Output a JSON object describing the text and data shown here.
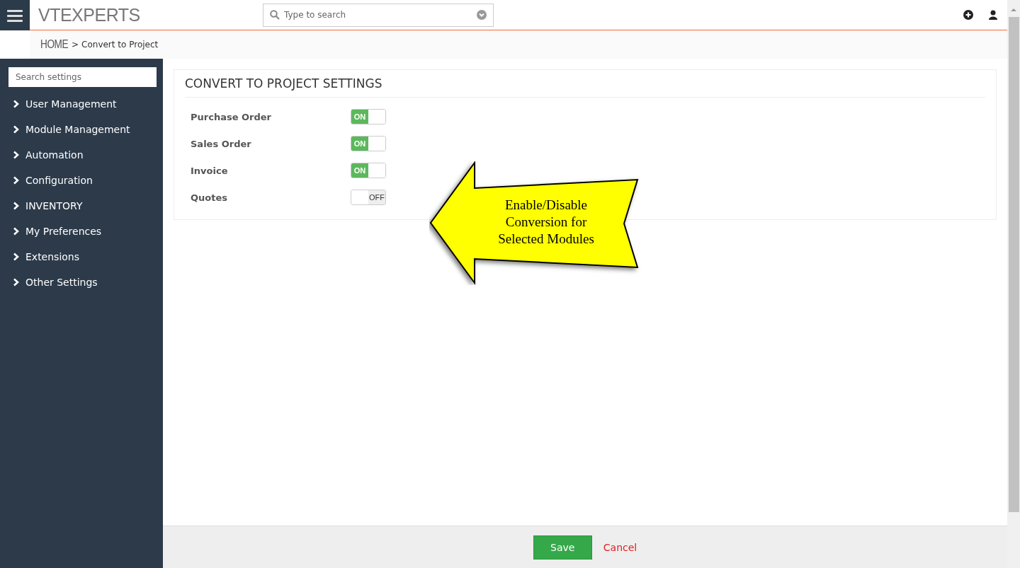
{
  "header": {
    "logo": "VTEXPERTS",
    "search": {
      "placeholder": "Type to search"
    }
  },
  "breadcrumb": {
    "home": "HOME",
    "separator": ">",
    "current": "Convert to Project"
  },
  "sidebar": {
    "search": {
      "placeholder": "Search settings"
    },
    "items": [
      {
        "label": "User Management",
        "expanded": false
      },
      {
        "label": "Module Management",
        "expanded": false
      },
      {
        "label": "Automation",
        "expanded": false
      },
      {
        "label": "Configuration",
        "expanded": false
      },
      {
        "label": "INVENTORY",
        "expanded": false
      },
      {
        "label": "My Preferences",
        "expanded": false
      },
      {
        "label": "Extensions",
        "expanded": false
      },
      {
        "label": "Other Settings",
        "expanded": false
      }
    ]
  },
  "settings": {
    "title": "CONVERT TO PROJECT SETTINGS",
    "rows": [
      {
        "label": "Purchase Order",
        "on": true,
        "state_text": "ON"
      },
      {
        "label": "Sales Order",
        "on": true,
        "state_text": "ON"
      },
      {
        "label": "Invoice",
        "on": true,
        "state_text": "ON"
      },
      {
        "label": "Quotes",
        "on": false,
        "state_text": "OFF"
      }
    ]
  },
  "callout": {
    "lines": [
      "Enable/Disable",
      "Conversion for",
      "Selected Modules"
    ]
  },
  "footer": {
    "save": "Save",
    "cancel": "Cancel"
  }
}
